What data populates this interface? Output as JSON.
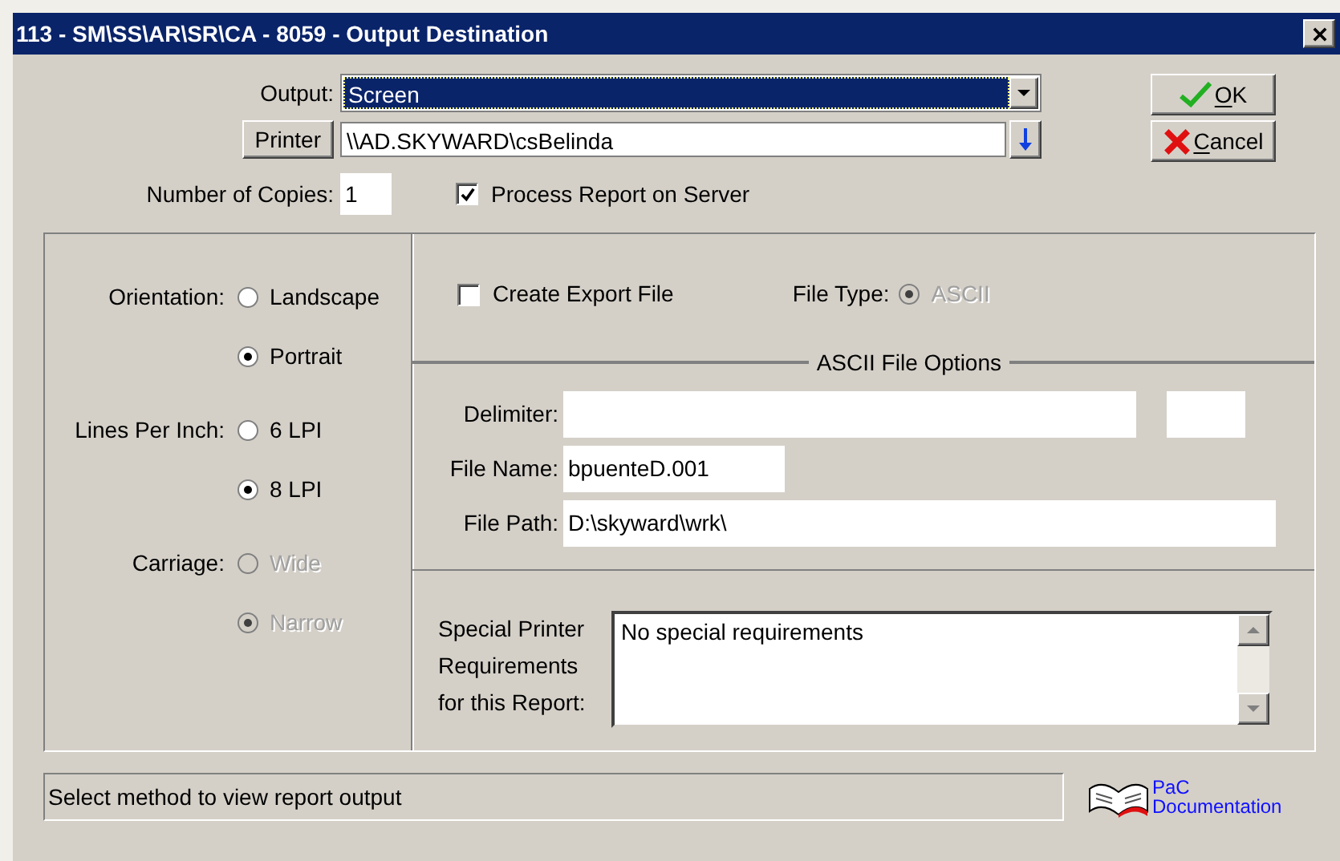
{
  "window": {
    "title": "113 - SM\\SS\\AR\\SR\\CA - 8059 - Output Destination"
  },
  "output": {
    "label": "Output:",
    "value": "Screen"
  },
  "printer": {
    "button": "Printer",
    "value": "\\\\AD.SKYWARD\\csBelinda"
  },
  "copies": {
    "label": "Number of Copies:",
    "value": "1"
  },
  "process_on_server": {
    "label": "Process Report on Server",
    "checked": true
  },
  "buttons": [
    {
      "label": "OK",
      "kind": "ok"
    },
    {
      "label": "Cancel",
      "kind": "cancel"
    }
  ],
  "orientation": {
    "label": "Orientation:",
    "options": [
      {
        "label": "Landscape",
        "selected": false,
        "disabled": false
      },
      {
        "label": "Portrait",
        "selected": true,
        "disabled": false
      }
    ]
  },
  "lines_per_inch": {
    "label": "Lines Per Inch:",
    "options": [
      {
        "label": "6 LPI",
        "selected": false,
        "disabled": false
      },
      {
        "label": "8 LPI",
        "selected": true,
        "disabled": false
      }
    ]
  },
  "carriage": {
    "label": "Carriage:",
    "options": [
      {
        "label": "Wide",
        "selected": false,
        "disabled": true
      },
      {
        "label": "Narrow",
        "selected": true,
        "disabled": true
      }
    ]
  },
  "create_export_file": {
    "label": "Create Export File",
    "checked": false
  },
  "file_type": {
    "label": "File Type:",
    "options": [
      {
        "label": "ASCII",
        "selected": true,
        "disabled": true
      }
    ]
  },
  "ascii_file_options": {
    "legend": "ASCII File Options",
    "delimiter": {
      "label": "Delimiter:"
    },
    "file_name": {
      "label": "File Name:",
      "value": "bpuenteD.001"
    },
    "file_path": {
      "label": "File Path:",
      "value": "D:\\skyward\\wrk\\"
    }
  },
  "special_requirements": {
    "label": "Special Printer Requirements for this Report:",
    "value": "No special requirements"
  },
  "status_bar": "Select method to view report output",
  "documentation_link": [
    "PaC",
    "Documentation"
  ]
}
